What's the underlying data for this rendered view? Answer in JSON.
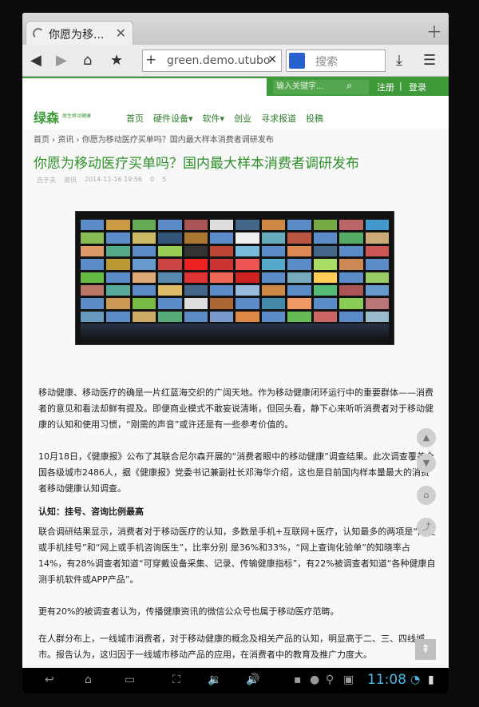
{
  "browser": {
    "tab_title": "你愿为移...",
    "url": "green.demo.utubo",
    "search_placeholder": "搜索"
  },
  "site": {
    "logo": "绿森",
    "logo_sub": "原生移动健康",
    "search_placeholder": "输入关键字...",
    "register": "注册",
    "separator": "|",
    "login": "登录",
    "nav": [
      "首页",
      "硬件设备▾",
      "软件▾",
      "创业",
      "寻求报道",
      "投稿"
    ]
  },
  "article": {
    "breadcrumb": "首页 › 资讯 › 你愿为移动医疗买单吗？国内最大样本消费者调研发布",
    "title": "你愿为移动医疗买单吗？国内最大样本消费者调研发布",
    "meta": {
      "author": "吉于夫",
      "category": "资讯",
      "date": "2014-11-16 19:56",
      "comments": "0",
      "views": "5"
    },
    "p1": "移动健康、移动医疗的确是一片红蓝海交织的广阔天地。作为移动健康闭环运行中的重要群体——消费者的意见和看法却鲜有提及。即便商业模式不敢妄说清晰，但回头看，静下心来听听消费者对于移动健康的认知和使用习惯，“刚需的声音”或许还是有一些参考价值的。",
    "p2": "10月18日，《健康报》公布了其联合尼尔森开展的“消费者眼中的移动健康”调查结果。此次调查覆盖全国各级城市2486人，据《健康报》党委书记兼副社长邓海华介绍，这也是目前国内样本量最大的消费者移动健康认知调查。",
    "h1": "认知：挂号、咨询比例最高",
    "p3": "联合调研结果显示，消费者对于移动医疗的认知，多数是手机+互联网+医疗，认知最多的两项是“网上或手机挂号”和“网上或手机咨询医生”，比率分别 是36%和33%，“网上查询化验单”的知晓率占14%，有28%调查者知道“可穿戴设备采集、记录、传输健康指标”，有22%被调查者知道“各种健康自 测手机软件或APP产品”。",
    "p4": "更有20%的被调查者认为，传播健康资讯的微信公众号也属于移动医疗范畴。",
    "p5": "在人群分布上，一线城市消费者，对于移动健康的概念及相关产品的认知，明显高于二、三、四线城市。报告认为，这归因于一线城市移动产品的应用，在消费者中的教育及推广力度大。"
  },
  "status": {
    "time": "11:08"
  }
}
